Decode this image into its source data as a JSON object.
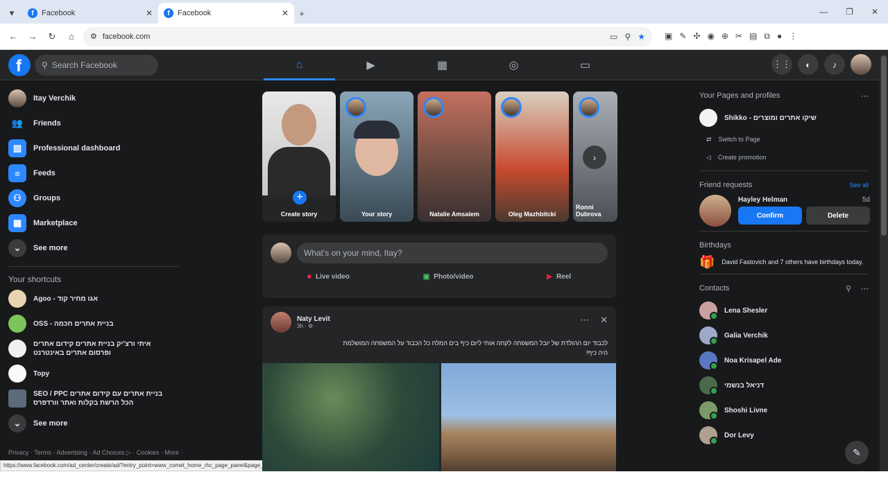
{
  "browser": {
    "tabs": [
      {
        "label": "Facebook"
      },
      {
        "label": "Facebook"
      }
    ],
    "url": "facebook.com"
  },
  "topnav": {
    "search_placeholder": "Search Facebook",
    "logo": "f"
  },
  "left": {
    "profile_name": "Itay Verchik",
    "items": [
      {
        "label": "Friends"
      },
      {
        "label": "Professional dashboard"
      },
      {
        "label": "Feeds"
      },
      {
        "label": "Groups"
      },
      {
        "label": "Marketplace"
      },
      {
        "label": "See more"
      }
    ],
    "shortcuts_title": "Your shortcuts",
    "shortcuts": [
      {
        "label": "Agoo - אגו מחיר קוד"
      },
      {
        "label": "OSS - בניית אתרים חכמה"
      },
      {
        "label": "איתי ורצ'יק בניית אתרים קידום אתרים ופרסום אתרים באינטרנט"
      },
      {
        "label": "Topy"
      },
      {
        "label": "SEO / PPC בניית אתרים עם קידום אתרים הכל הרשת בקלות ואתר וורדפרס"
      },
      {
        "label": "See more"
      }
    ],
    "footer": "Privacy · Terms · Advertising · Ad Choices ▷ · Cookies · More ·"
  },
  "status_url": "https://www.facebook.com/ad_center/create/ad/?entry_point=www_comet_home_rhc_page_panel&page_id=150916050670346",
  "stories": [
    {
      "name": "Create story"
    },
    {
      "name": "Your story"
    },
    {
      "name": "Natalie Amsalem"
    },
    {
      "name": "Oleg Mazhbitcki"
    },
    {
      "name": "Ronni Dubrova"
    }
  ],
  "composer": {
    "placeholder": "What's on your mind, Itay?",
    "live": "Live video",
    "photo": "Photo/video",
    "reel": "Reel"
  },
  "post": {
    "author": "Naty Levit",
    "meta": "3h · ⚙",
    "text_line1": "לכבוד יום ההולדת של יובל המשפחה לקחה אותי ליום כיף בים המלח כל הכבוד על המשפחה המושלמת",
    "text_line2": "היה כיף!"
  },
  "right": {
    "pages_title": "Your Pages and profiles",
    "page_name": "Shikko - שיקו אתרים ומוצרים",
    "switch": "Switch to Page",
    "promo": "Create promotion",
    "friend_requests_title": "Friend requests",
    "see_all": "See all",
    "requester": "Hayley Helman",
    "requester_age": "5d",
    "confirm": "Confirm",
    "delete": "Delete",
    "birthdays_title": "Birthdays",
    "bday_text": "David Fastovich and 7 others have birthdays today.",
    "contacts_title": "Contacts",
    "contacts": [
      {
        "name": "Lena Shesler"
      },
      {
        "name": "Galia Verchik"
      },
      {
        "name": "Noa Krisapel Ade"
      },
      {
        "name": "דניאל בנשמי"
      },
      {
        "name": "Shoshi Livne"
      },
      {
        "name": "Dor Levy"
      }
    ]
  },
  "colors": {
    "accent": "#1877f2",
    "bg": "#18191a",
    "panel": "#242526"
  }
}
